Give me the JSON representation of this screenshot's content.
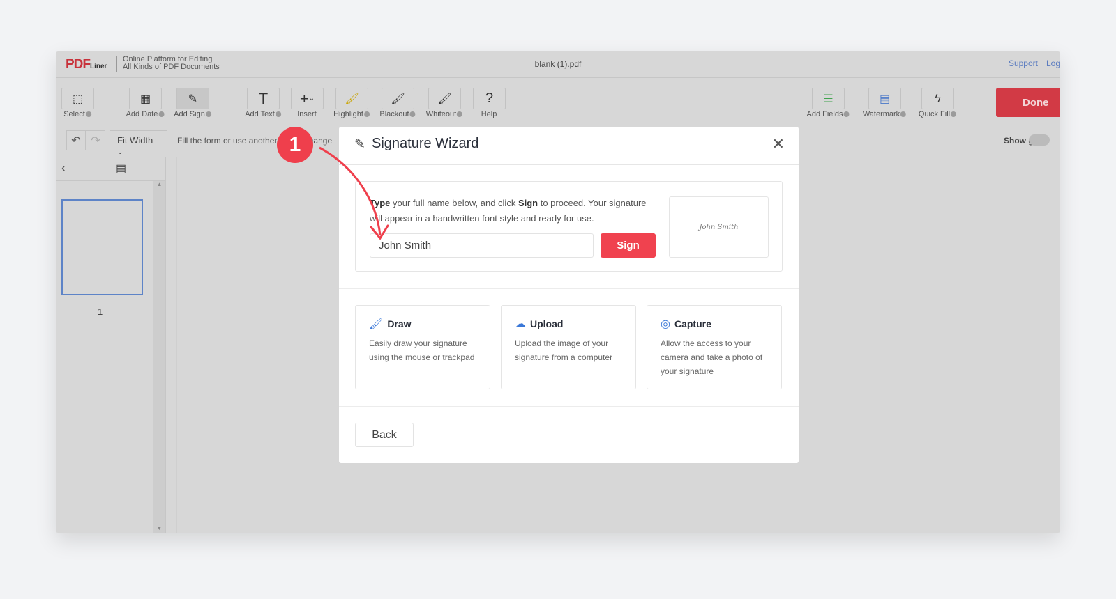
{
  "header": {
    "logo": "PDF",
    "logo_sub": "Liner",
    "tagline_1": "Online Platform for Editing",
    "tagline_2": "All Kinds of PDF Documents",
    "filename": "blank (1).pdf",
    "links": [
      "Support",
      "Log"
    ]
  },
  "toolbar": {
    "select": "Select",
    "add_date": "Add Date",
    "add_sign": "Add Sign",
    "add_text": "Add Text",
    "insert": "Insert",
    "highlight": "Highlight",
    "blackout": "Blackout",
    "whiteout": "Whiteout",
    "help": "Help",
    "add_fields": "Add Fields",
    "watermark": "Watermark",
    "quick_fill": "Quick Fill",
    "done": "Done"
  },
  "subbar": {
    "zoom": "Fit Width",
    "hint": "Fill the form or use another tool to change",
    "show_grid": "Show grid"
  },
  "sidebar": {
    "page_number": "1"
  },
  "modal": {
    "title": "Signature Wizard",
    "desc_bold_1": "Type",
    "desc_1": " your full name below, and click ",
    "desc_bold_2": "Sign",
    "desc_2": " to proceed. Your signature will appear in a handwritten font style and ready for use.",
    "name_value": "John Smith",
    "sign_label": "Sign",
    "preview": "John Smith",
    "options": [
      {
        "title": "Draw",
        "desc": "Easily draw your signature using the mouse or trackpad",
        "icon": "brush-icon"
      },
      {
        "title": "Upload",
        "desc": "Upload the image of your signature from a computer",
        "icon": "cloud-upload-icon"
      },
      {
        "title": "Capture",
        "desc": "Allow the access to your camera and take a photo of your signature",
        "icon": "camera-icon"
      }
    ],
    "back_label": "Back"
  },
  "annotation": {
    "step": "1",
    "color": "#ef3f4c"
  }
}
